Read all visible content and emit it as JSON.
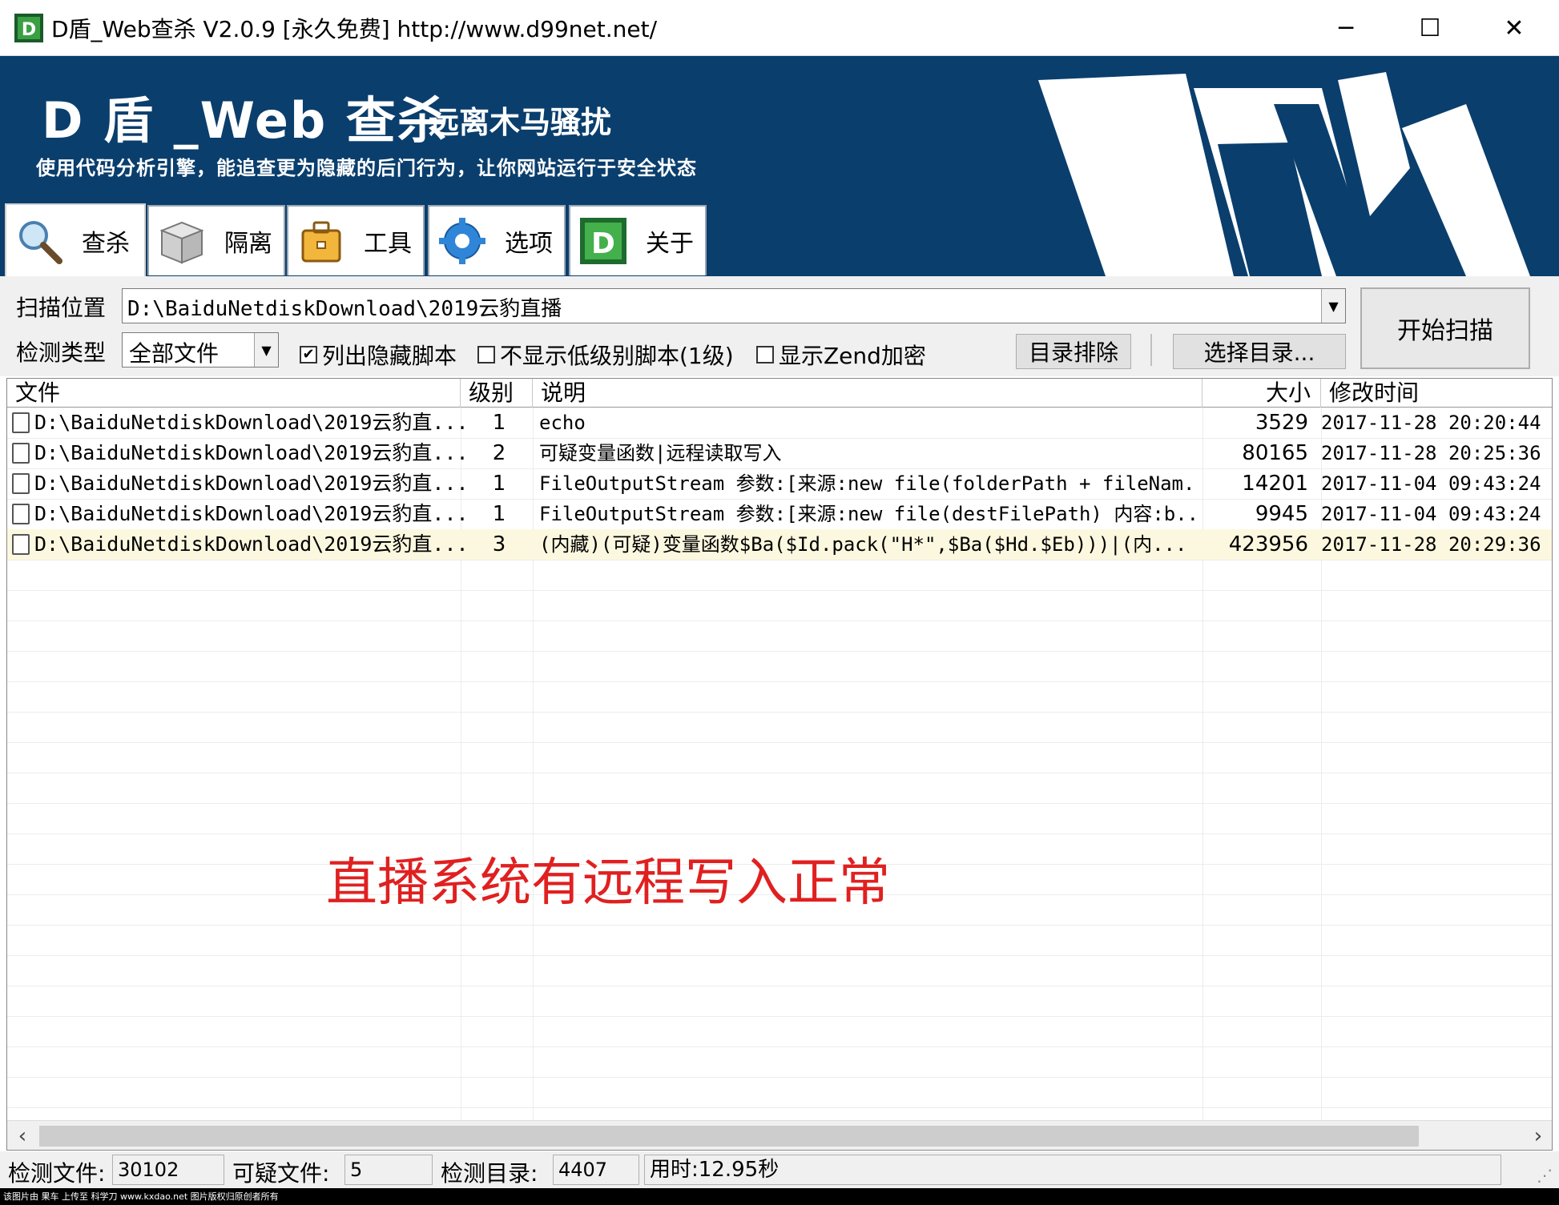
{
  "window": {
    "title": "D盾_Web查杀 V2.0.9 [永久免费] http://www.d99net.net/",
    "minimize": "─",
    "maximize": "☐",
    "close": "✕"
  },
  "banner": {
    "title": "D 盾 _Web 查杀",
    "slogan": "远离木马骚扰",
    "description": "使用代码分析引擎，能追查更为隐藏的后门行为，让你网站运行于安全状态",
    "bg_color": "#0a3e6d"
  },
  "tabs": [
    {
      "label": "查杀",
      "icon": "magnifier-icon",
      "active": true
    },
    {
      "label": "隔离",
      "icon": "box-icon",
      "active": false
    },
    {
      "label": "工具",
      "icon": "toolbox-icon",
      "active": false
    },
    {
      "label": "选项",
      "icon": "gear-icon",
      "active": false
    },
    {
      "label": "关于",
      "icon": "d-logo-icon",
      "active": false
    }
  ],
  "controls": {
    "scan_location_label": "扫描位置",
    "scan_location_value": "D:\\BaiduNetdiskDownload\\2019云豹直播",
    "detect_type_label": "检测类型",
    "detect_type_value": "全部文件",
    "checkbox_hidden": {
      "label": "列出隐藏脚本",
      "checked": true
    },
    "checkbox_lowlevel": {
      "label": "不显示低级别脚本(1级)",
      "checked": false
    },
    "checkbox_zend": {
      "label": "显示Zend加密",
      "checked": false
    },
    "exclude_button": "目录排除",
    "select_dir_button": "选择目录...",
    "start_button": "开始扫描"
  },
  "table": {
    "columns": [
      "文件",
      "级别",
      "说明",
      "大小",
      "修改时间"
    ],
    "rows": [
      {
        "file": "D:\\BaiduNetdiskDownload\\2019云豹直...",
        "level": "1",
        "desc": "echo",
        "size": "3529",
        "time": "2017-11-28 20:20:44"
      },
      {
        "file": "D:\\BaiduNetdiskDownload\\2019云豹直...",
        "level": "2",
        "desc": "可疑变量函数|远程读取写入",
        "size": "80165",
        "time": "2017-11-28 20:25:36"
      },
      {
        "file": "D:\\BaiduNetdiskDownload\\2019云豹直...",
        "level": "1",
        "desc": "FileOutputStream 参数:[来源:new file(folderPath + fileNam...",
        "size": "14201",
        "time": "2017-11-04 09:43:24"
      },
      {
        "file": "D:\\BaiduNetdiskDownload\\2019云豹直...",
        "level": "1",
        "desc": "FileOutputStream 参数:[来源:new file(destFilePath) 内容:b...",
        "size": "9945",
        "time": "2017-11-04 09:43:24"
      },
      {
        "file": "D:\\BaiduNetdiskDownload\\2019云豹直...",
        "level": "3",
        "desc": "(内藏)(可疑)变量函数$Ba($Id.pack(\"H*\",$Ba($Hd.$Eb)))|(内...",
        "size": "423956",
        "time": "2017-11-28 20:29:36"
      }
    ]
  },
  "annotation": "直播系统有远程写入正常",
  "statusbar": {
    "files_label": "检测文件:",
    "files_value": "30102",
    "suspicious_label": "可疑文件:",
    "suspicious_value": "5",
    "dirs_label": "检测目录:",
    "dirs_value": "4407",
    "elapsed": "用时:12.95秒"
  },
  "watermark": "该图片由 果车 上传至 科学刀 www.kxdao.net 图片版权归原创者所有"
}
